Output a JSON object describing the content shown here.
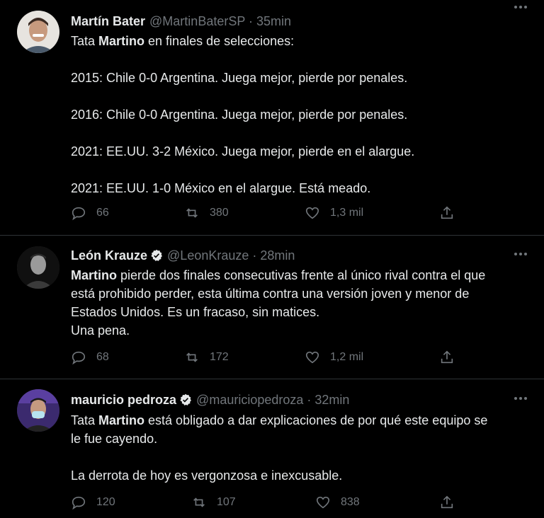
{
  "tweets": [
    {
      "name": "Martín Bater",
      "verified": false,
      "handle": "@MartinBaterSP · 35min",
      "lines": [
        [
          "Tata ",
          {
            "bold": "Martino"
          },
          " en finales de selecciones:"
        ],
        [],
        [
          "2015: Chile 0-0 Argentina. Juega mejor, pierde por penales."
        ],
        [],
        [
          "2016: Chile 0-0 Argentina. Juega mejor, pierde por penales."
        ],
        [],
        [
          "2021: EE.UU. 3-2 México. Juega mejor, pierde en el alargue."
        ],
        [],
        [
          "2021: EE.UU. 1-0 México en el alargue. Está meado."
        ]
      ],
      "replies": "66",
      "retweets": "380",
      "likes": "1,3 mil"
    },
    {
      "name": "León Krauze",
      "verified": true,
      "handle": "@LeonKrauze · 28min",
      "lines": [
        [
          {
            "bold": "Martino"
          },
          " pierde dos finales consecutivas frente al único rival contra el que"
        ],
        [
          "está prohibido perder, esta última contra una versión joven y menor de"
        ],
        [
          "Estados Unidos. Es un fracaso, sin matices."
        ],
        [
          "Una pena."
        ]
      ],
      "replies": "68",
      "retweets": "172",
      "likes": "1,2 mil"
    },
    {
      "name": "mauricio pedroza",
      "verified": true,
      "handle": "@mauriciopedroza · 32min",
      "lines": [
        [
          "Tata ",
          {
            "bold": "Martino"
          },
          " está obligado a dar explicaciones de por qué este equipo se"
        ],
        [
          "le fue cayendo."
        ],
        [],
        [
          "La derrota de hoy es vergonzosa e inexcusable."
        ]
      ],
      "replies": "120",
      "retweets": "107",
      "likes": "838"
    }
  ],
  "colors": {
    "background": "#000000",
    "text": "#e7e9ea",
    "secondary": "#71767b",
    "divider": "#2f3336",
    "verified": "#1d9bf0"
  }
}
